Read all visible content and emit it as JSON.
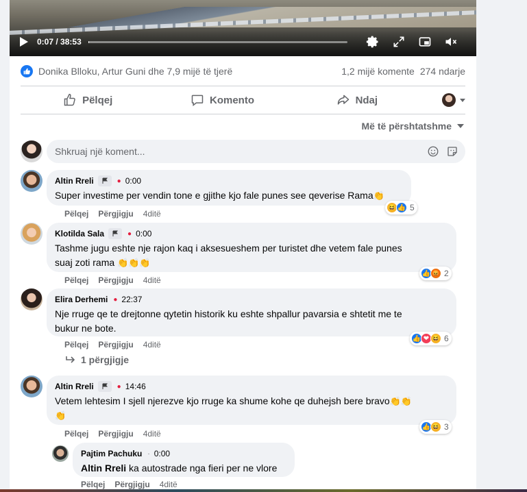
{
  "video": {
    "current_time": "0:07",
    "duration": "38:53",
    "progress_fraction": 0.003,
    "icons": [
      "play-icon",
      "settings-gear-icon",
      "fullscreen-icon",
      "mini-player-icon",
      "muted-volume-icon"
    ]
  },
  "stats": {
    "likers": "Donika Blloku, Artur Guni dhe 7,9 mijë të tjerë",
    "comments": "1,2 mijë komente",
    "shares": "274 ndarje"
  },
  "actions": {
    "like": "Pëlqej",
    "comment": "Komento",
    "share": "Ndaj"
  },
  "sort": {
    "label": "Më të përshtatshme"
  },
  "write": {
    "placeholder": "Shkruaj një koment..."
  },
  "comment_actions": {
    "like": "Pëlqej",
    "reply": "Përgjigju"
  },
  "comments": [
    {
      "name": "Altin Rreli",
      "time": "0:00",
      "text": "Super investime per vendin tone e gjithe kjo fale punes see qeverise Rama",
      "reactions": [
        "haha",
        "like"
      ],
      "reaction_count": "5",
      "age": "4ditë"
    },
    {
      "name": "Klotilda Sala",
      "time": "0:00",
      "text_line1": "Tashme jugu eshte nje rajon kaq i aksesueshem per turistet dhe vetem fale punes",
      "text_line2": "suaj zoti rama",
      "reactions": [
        "like",
        "angry"
      ],
      "reaction_count": "2",
      "age": "4ditë"
    },
    {
      "name": "Elira Derhemi",
      "time": "22:37",
      "text_line1": "Nje rruge qe te drejtonne qytetin historik ku eshte shpallur pavarsia e shtetit me te",
      "text_line2": "bukur ne bote.",
      "reactions": [
        "like",
        "love",
        "haha"
      ],
      "reaction_count": "6",
      "age": "4ditë",
      "replies": "1 përgjigje"
    },
    {
      "name": "Altin Rreli",
      "time": "14:46",
      "text": "Vetem lehtesim I sjell njerezve kjo rruge ka shume kohe qe duhejsh bere bravo",
      "reactions": [
        "like",
        "haha"
      ],
      "reaction_count": "3",
      "age": "4ditë"
    }
  ],
  "reply": {
    "name": "Pajtim Pachuku",
    "time": "0:00",
    "mention": "Altin Rreli",
    "text": "ka autostrade nga fieri per ne vlore",
    "age": "4ditë"
  }
}
